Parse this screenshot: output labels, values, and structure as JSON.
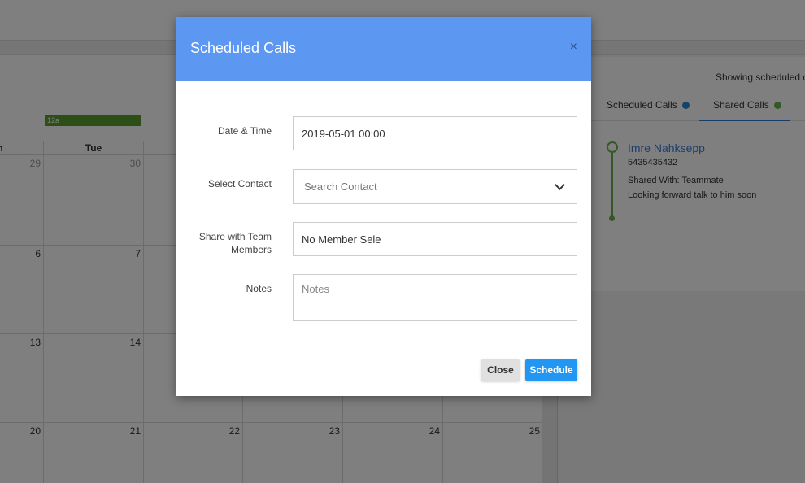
{
  "calendar": {
    "day_headers": [
      "n",
      "Tue"
    ],
    "weeks": [
      [
        "29",
        "30"
      ],
      [
        "6",
        "7"
      ],
      [
        "13",
        "14"
      ],
      [
        "20",
        "21",
        "22",
        "23",
        "24",
        "25"
      ]
    ],
    "event_label": "12a"
  },
  "panel": {
    "showing_text": "Showing scheduled ca",
    "tabs": [
      {
        "label": "Scheduled Calls",
        "dot_color": "#2f86d1"
      },
      {
        "label": "Shared Calls",
        "dot_color": "#6ab04c"
      }
    ],
    "call": {
      "name": "Imre Nahksepp",
      "phone": "5435435432",
      "shared_with": "Shared With: Teammate",
      "note": "Looking forward talk to him soon"
    }
  },
  "modal": {
    "title": "Scheduled Calls",
    "close_x": "×",
    "fields": {
      "datetime_label": "Date & Time",
      "datetime_value": "2019-05-01 00:00",
      "contact_label": "Select Contact",
      "contact_placeholder": "Search Contact",
      "team_label": "Share with Team Members",
      "team_value": "No Member Sele",
      "notes_label": "Notes",
      "notes_placeholder": "Notes"
    },
    "buttons": {
      "close": "Close",
      "schedule": "Schedule"
    }
  },
  "colors": {
    "header": "#5c97f2",
    "primary_button": "#2196f3",
    "event": "#5b9c2b"
  }
}
